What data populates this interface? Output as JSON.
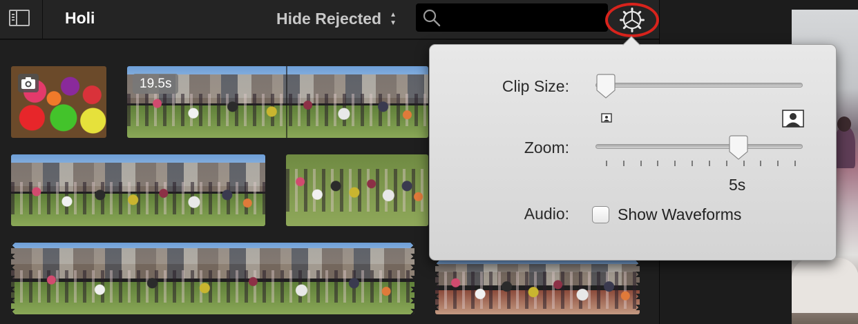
{
  "toolbar": {
    "event_title": "Holi",
    "filter_label": "Hide Rejected",
    "search_placeholder": "",
    "icons": [
      "sidebar-toggle-icon",
      "search-icon",
      "gear-icon"
    ],
    "highlight_color": "#d8231c"
  },
  "clips": [
    {
      "type": "photo",
      "badge_icon": "camera-icon"
    },
    {
      "type": "video",
      "duration": "19.5s"
    },
    {
      "type": "video"
    },
    {
      "type": "video"
    },
    {
      "type": "video"
    },
    {
      "type": "video"
    }
  ],
  "settings_popover": {
    "clip_size_label": "Clip Size:",
    "clip_size_value": 0.0,
    "zoom_label": "Zoom:",
    "zoom_value_fraction": 0.71,
    "zoom_value_text": "5s",
    "audio_label": "Audio:",
    "show_waveforms_label": "Show Waveforms",
    "show_waveforms_checked": false
  }
}
